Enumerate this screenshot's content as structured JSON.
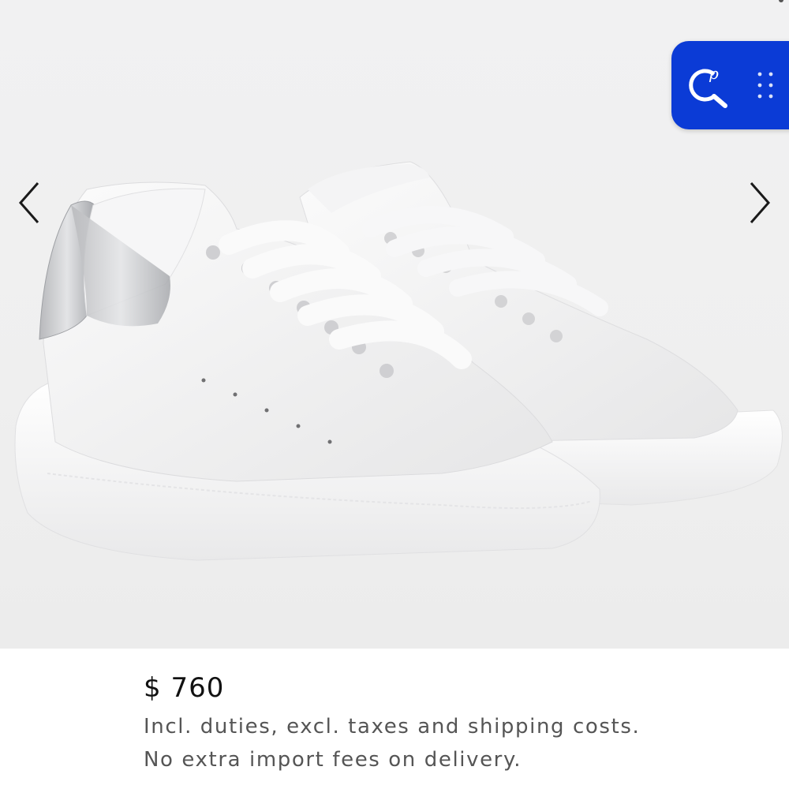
{
  "product": {
    "image_alt": "White leather oversized sneaker pair with silver heel tab",
    "price": "$ 760",
    "notes": [
      "Incl. duties, excl. taxes and shipping costs.",
      "No extra import fees on delivery."
    ]
  },
  "gallery": {
    "prev_icon": "chevron-left-icon",
    "next_icon": "chevron-right-icon"
  },
  "widget": {
    "logo_icon": "cp-search-icon",
    "grip_icon": "drag-grip-icon",
    "brand_color": "#0b3bd6"
  }
}
